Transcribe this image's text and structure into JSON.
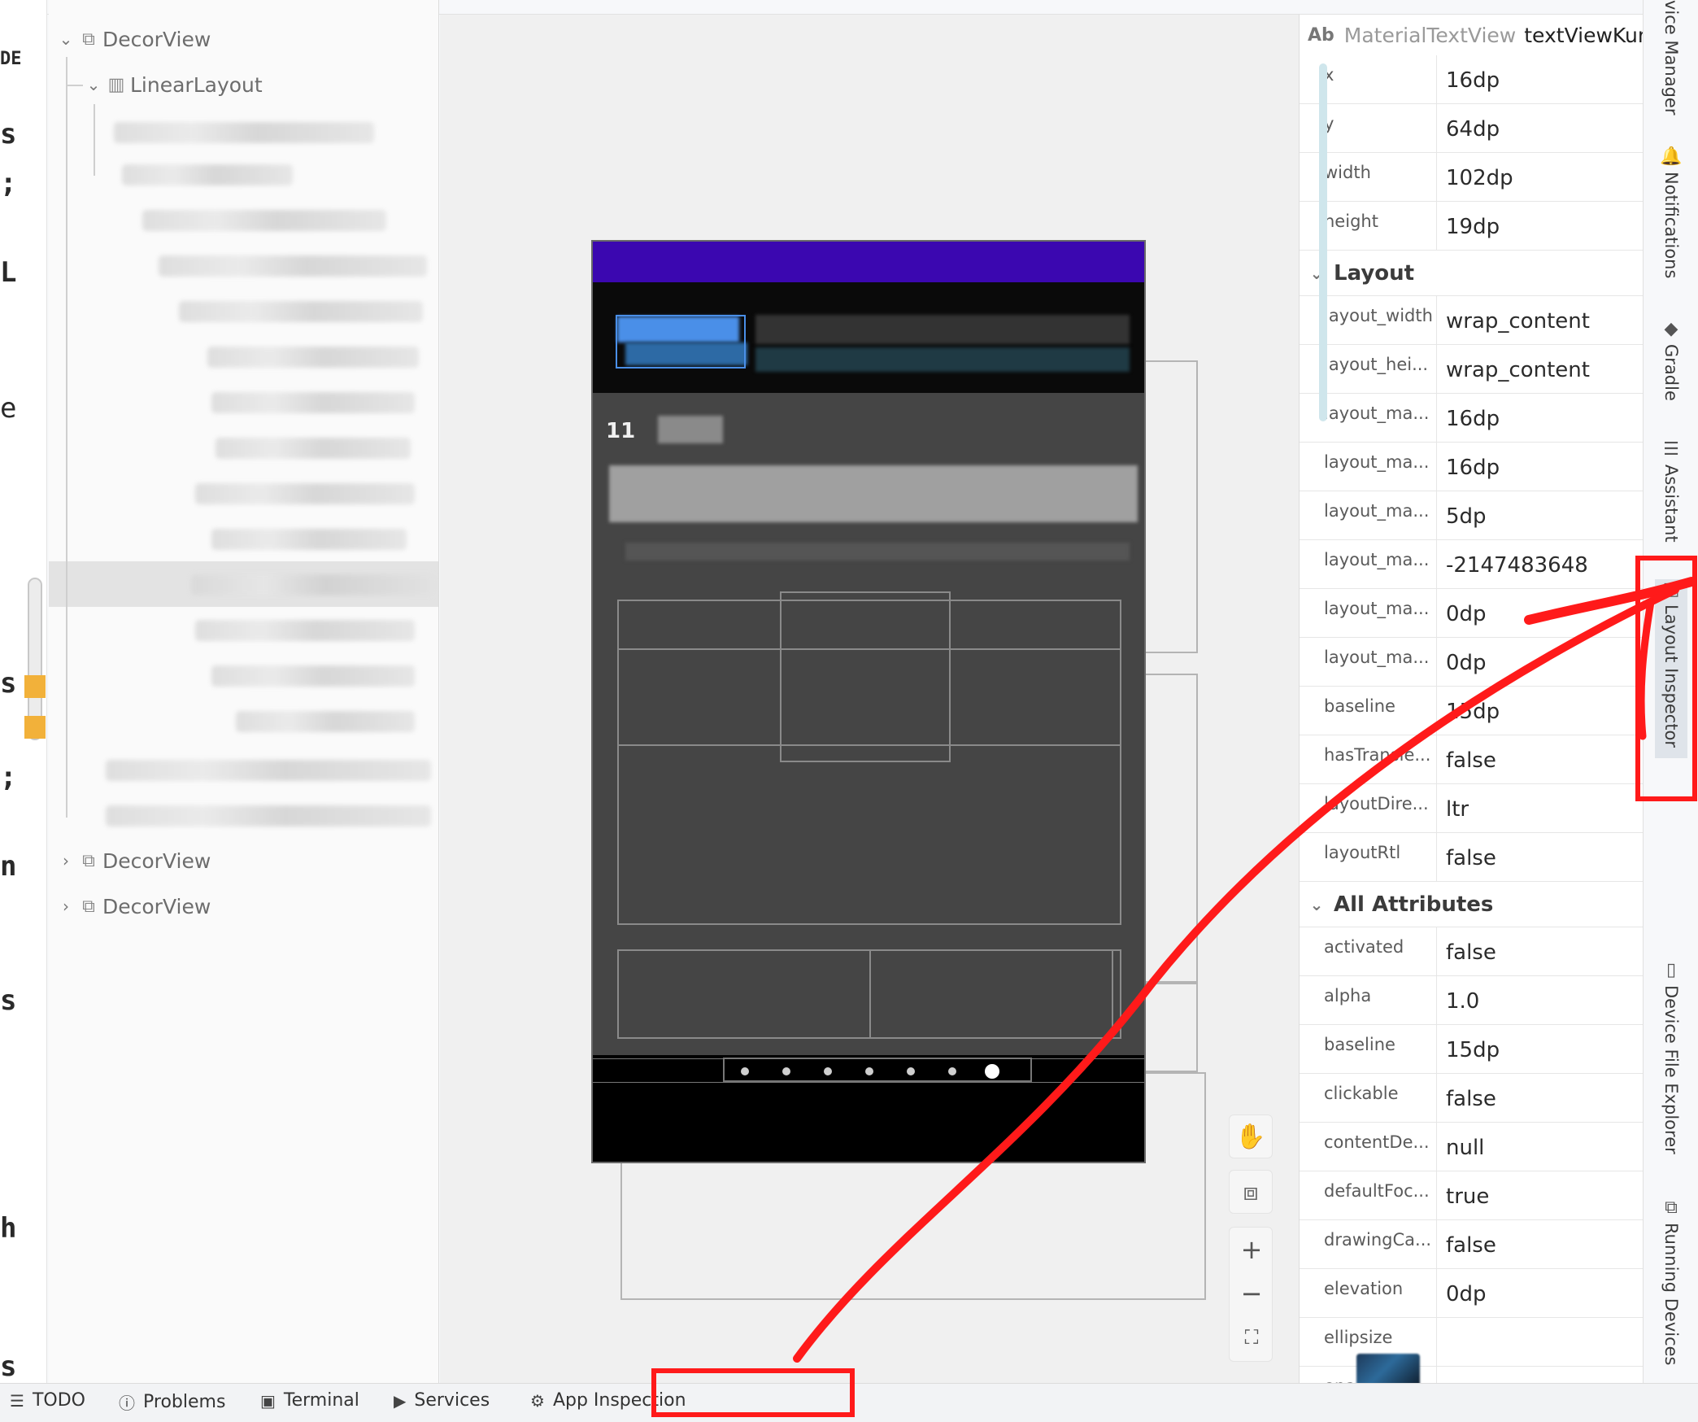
{
  "editor_fragments": [
    {
      "text": "DE",
      "color": "#c6c6c6"
    },
    {
      "text": "s",
      "color": "#6f2a8a"
    },
    {
      "text": ";",
      "color": "#1b9a9a"
    },
    {
      "text": "L",
      "color": "#6f2a8a"
    },
    {
      "text": "e",
      "color": "#1b7ab8"
    },
    {
      "text": "s",
      "color": "#6f2a8a"
    },
    {
      "text": ";",
      "color": "#1b9a9a"
    },
    {
      "text": "n",
      "color": "#6f2a8a"
    },
    {
      "text": "s",
      "color": "#6f2a8a"
    },
    {
      "text": "h",
      "color": "#6f2a8a"
    },
    {
      "text": "s",
      "color": "#6f2a8a"
    }
  ],
  "tree": {
    "nodes": [
      {
        "label": "DecorView",
        "icon": "view-icon",
        "expanded": true
      },
      {
        "label": "LinearLayout",
        "icon": "linear-layout-icon",
        "expanded": true
      },
      {
        "label": "DecorView",
        "icon": "view-icon",
        "expanded": false
      },
      {
        "label": "DecorView",
        "icon": "view-icon",
        "expanded": false
      }
    ]
  },
  "canvas": {
    "phone_number_fragment": "11",
    "dots": 7
  },
  "attributes": {
    "header": {
      "badge": "Ab",
      "class_name": "MaterialTextView",
      "view_id": "textViewKunde"
    },
    "basic": [
      {
        "key": "x",
        "value": "16dp"
      },
      {
        "key": "y",
        "value": "64dp"
      },
      {
        "key": "width",
        "value": "102dp"
      },
      {
        "key": "height",
        "value": "19dp"
      }
    ],
    "layout_title": "Layout",
    "layout": [
      {
        "key": "layout_width",
        "value": "wrap_content"
      },
      {
        "key": "layout_hei...",
        "value": "wrap_content"
      },
      {
        "key": "layout_ma...",
        "value": "16dp"
      },
      {
        "key": "layout_ma...",
        "value": "16dp"
      },
      {
        "key": "layout_ma...",
        "value": "5dp"
      },
      {
        "key": "layout_ma...",
        "value": "-2147483648"
      },
      {
        "key": "layout_ma...",
        "value": "0dp"
      },
      {
        "key": "layout_ma...",
        "value": "0dp"
      },
      {
        "key": "baseline",
        "value": "15dp"
      },
      {
        "key": "hasTransie...",
        "value": "false"
      },
      {
        "key": "layoutDire...",
        "value": "ltr"
      },
      {
        "key": "layoutRtl",
        "value": "false"
      }
    ],
    "all_title": "All Attributes",
    "all": [
      {
        "key": "activated",
        "value": "false"
      },
      {
        "key": "alpha",
        "value": "1.0"
      },
      {
        "key": "baseline",
        "value": "15dp"
      },
      {
        "key": "clickable",
        "value": "false"
      },
      {
        "key": "contentDe...",
        "value": "null"
      },
      {
        "key": "defaultFoc...",
        "value": "true"
      },
      {
        "key": "drawingCa...",
        "value": "false"
      },
      {
        "key": "elevation",
        "value": "0dp"
      },
      {
        "key": "ellipsize",
        "value": ""
      },
      {
        "key": "ena...",
        "value": "true"
      }
    ]
  },
  "right_tabs": [
    {
      "label": "vice Manager",
      "icon": "device-manager-icon"
    },
    {
      "label": "Notifications",
      "icon": "bell-icon"
    },
    {
      "label": "Gradle",
      "icon": "gradle-icon"
    },
    {
      "label": "Assistant",
      "icon": "assistant-icon"
    },
    {
      "label": "Layout Inspector",
      "icon": "layout-inspector-icon"
    },
    {
      "label": "Device File Explorer",
      "icon": "device-file-icon"
    },
    {
      "label": "Running Devices",
      "icon": "running-devices-icon"
    }
  ],
  "bottom_tabs": [
    {
      "label": "TODO",
      "icon": "list-icon"
    },
    {
      "label": "Problems",
      "icon": "problems-icon"
    },
    {
      "label": "Terminal",
      "icon": "terminal-icon"
    },
    {
      "label": "Services",
      "icon": "services-icon"
    },
    {
      "label": "App Inspection",
      "icon": "app-inspection-icon"
    }
  ],
  "colors": {
    "annotation": "#ff1a1a",
    "app_bar": "#3b07b0",
    "selection_highlight": "#4a8fe8"
  }
}
